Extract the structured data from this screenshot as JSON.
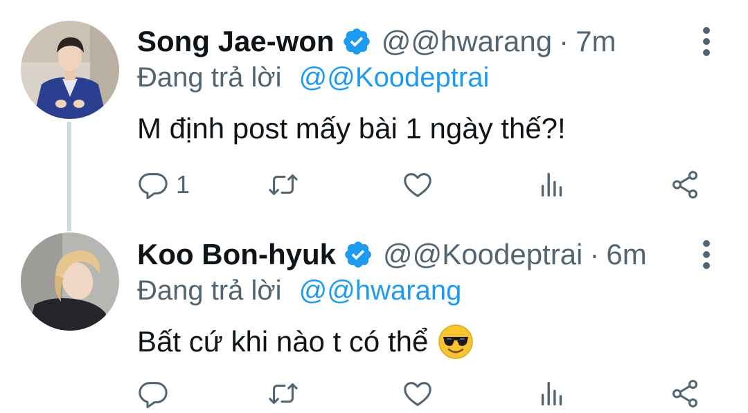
{
  "colors": {
    "accent": "#1d9bf0",
    "secondary_text": "#536471",
    "primary_text": "#0f1419",
    "thread_line": "#cfd9de"
  },
  "tweets": [
    {
      "name": "Song Jae-won",
      "handle": "@@hwarang",
      "separator": "·",
      "time": "7m",
      "reply_prefix": "Đang trả lời",
      "reply_to": "@@Koodeptrai",
      "text": "M định post mấy bài 1 ngày thế?!",
      "reply_count": "1",
      "icons": [
        "verified-badge-icon",
        "more-vertical-icon",
        "reply-icon",
        "retweet-icon",
        "like-icon",
        "views-icon",
        "share-icon"
      ]
    },
    {
      "name": "Koo Bon-hyuk",
      "handle": "@@Koodeptrai",
      "separator": "·",
      "time": "6m",
      "reply_prefix": "Đang trả lời",
      "reply_to": "@@hwarang",
      "text": "Bất cứ khi nào t có thể",
      "emoji": "sunglasses-face-emoji",
      "icons": [
        "verified-badge-icon",
        "more-vertical-icon",
        "reply-icon",
        "retweet-icon",
        "like-icon",
        "views-icon",
        "share-icon"
      ]
    }
  ]
}
